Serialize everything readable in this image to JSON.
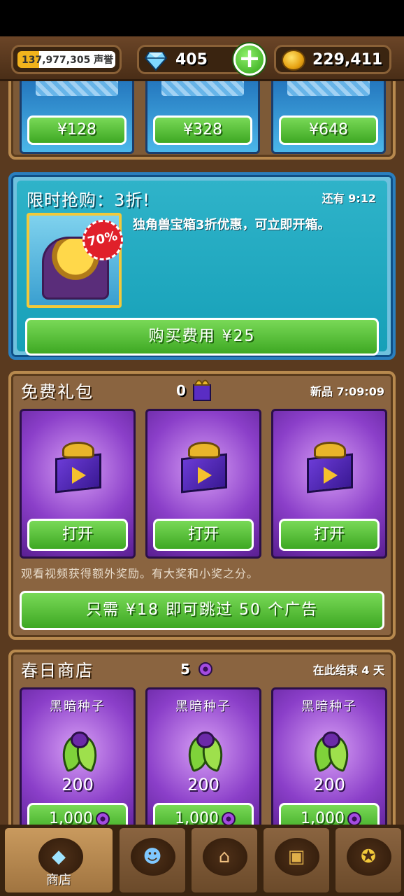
{
  "topbar": {
    "reputation": "137,977,305 声誉",
    "gems": "405",
    "gold": "229,411"
  },
  "gem_packs": [
    {
      "price": "¥128"
    },
    {
      "price": "¥328"
    },
    {
      "price": "¥648"
    }
  ],
  "flash_sale": {
    "title": "限时抢购：3折!",
    "timer": "还有 9:12",
    "badge": "70%",
    "description": "独角兽宝箱3折优惠，可立即开箱。",
    "buy_label": "购买费用 ¥25"
  },
  "free_gifts": {
    "title": "免费礼包",
    "count": "0",
    "timer": "新品 7:09:09",
    "cards": [
      {
        "button": "打开"
      },
      {
        "button": "打开"
      },
      {
        "button": "打开"
      }
    ],
    "note": "观看视频获得额外奖励。有大奖和小奖之分。",
    "skip_label": "只需 ¥18 即可跳过 50 个广告"
  },
  "spring_shop": {
    "title": "春日商店",
    "count": "5",
    "timer": "在此结束 4 天",
    "items": [
      {
        "name": "黑暗种子",
        "amount": "200",
        "price": "1,000"
      },
      {
        "name": "黑暗种子",
        "amount": "200",
        "price": "1,000"
      },
      {
        "name": "黑暗种子",
        "amount": "200",
        "price": "1,000"
      }
    ]
  },
  "tabs": [
    {
      "label": "商店",
      "icon": "diamond-icon",
      "active": true
    },
    {
      "label": "",
      "icon": "people-icon",
      "active": false
    },
    {
      "label": "",
      "icon": "house-icon",
      "active": false
    },
    {
      "label": "",
      "icon": "chest-icon",
      "active": false
    },
    {
      "label": "",
      "icon": "medal-icon",
      "active": false
    }
  ],
  "colors": {
    "button_green": "#3ea823",
    "flash_teal": "#16a0b8",
    "card_purple": "#8b3fc9",
    "wood": "#8a6440"
  }
}
